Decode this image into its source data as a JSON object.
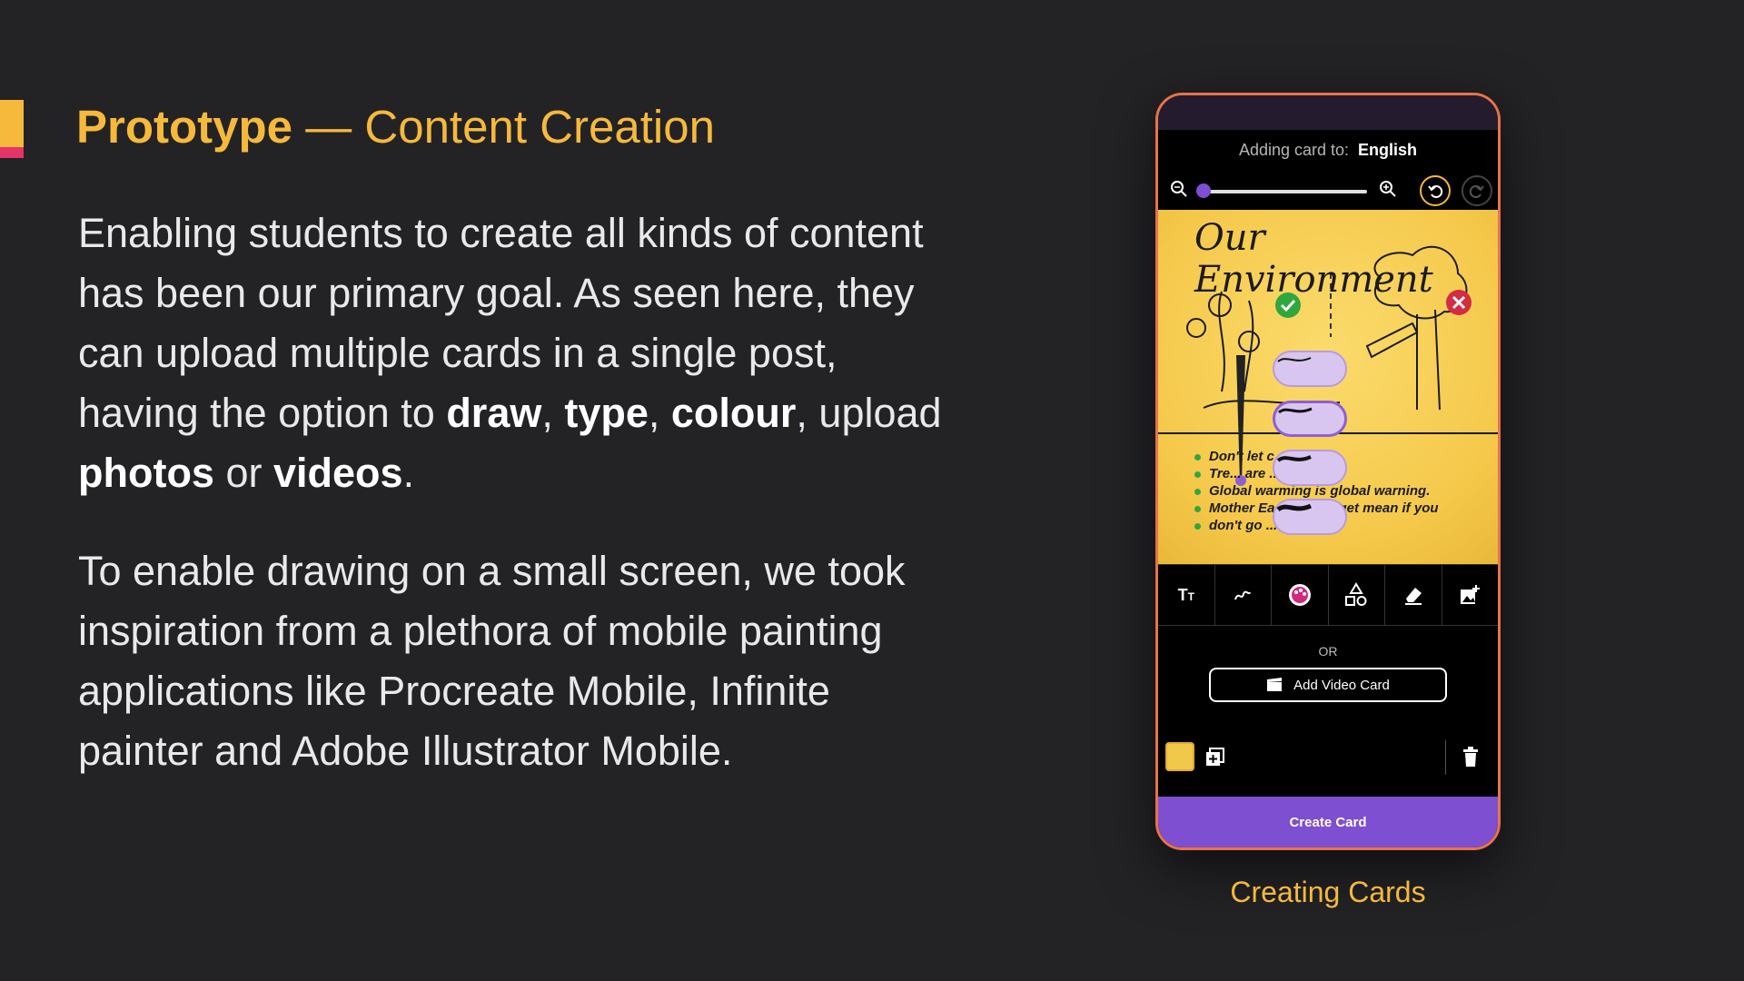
{
  "slide": {
    "title_bold": "Prototype",
    "title_dash": " — ",
    "title_rest": "Content Creation",
    "para1": {
      "t1": "Enabling students to create all kinds of content has been our primary goal. As seen here, they can upload multiple cards in a single post, having the option to ",
      "draw": "draw",
      "t2": ", ",
      "type": "type",
      "t3": ", ",
      "colour": "colour",
      "t4": ", upload ",
      "photos": "photos",
      "t5": " or ",
      "videos": "videos",
      "t6": "."
    },
    "para2": "To enable drawing on a small screen, we took inspiration from a plethora of mobile painting applications like Procreate Mobile, Infinite painter and Adobe Illustrator Mobile.",
    "caption": "Creating Cards"
  },
  "phone": {
    "adding_label": "Adding card to:",
    "adding_lang": "English",
    "zoom_level": 0.02,
    "canvas_title": "Our Environment",
    "bullets": [
      "Don't let c... dry up.",
      "Tre... are ...cut them.",
      "Global warming is global warning.",
      "Mother Ea... ...ng to get mean if you",
      "don't go ..."
    ],
    "tools": [
      "text-icon",
      "draw-icon",
      "palette-icon",
      "shapes-icon",
      "eraser-icon",
      "add-photo-icon"
    ],
    "or_label": "OR",
    "video_button": "Add Video Card",
    "create_button": "Create Card",
    "colors": {
      "accent": "#f6b93b",
      "primary": "#7e4fd0",
      "canvas": "#f5c84a",
      "pink": "#e6336b"
    }
  }
}
